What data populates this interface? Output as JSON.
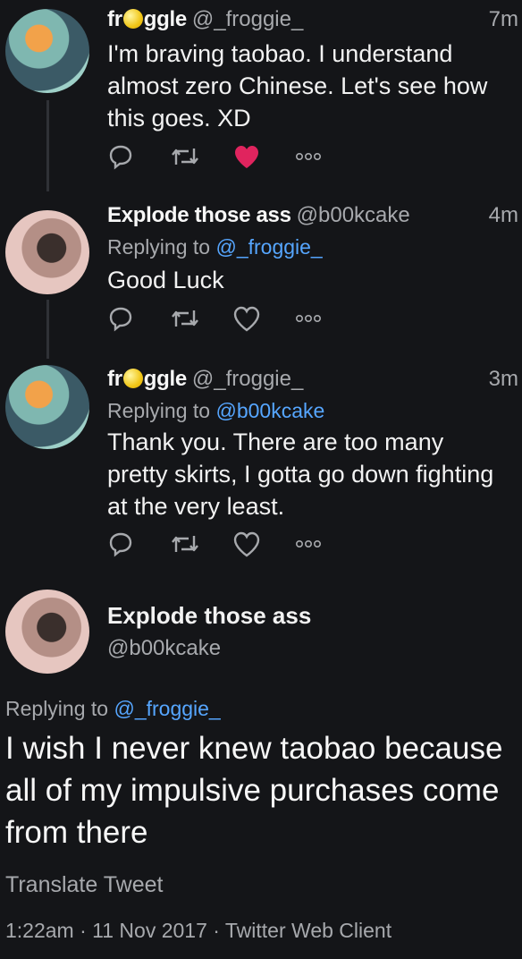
{
  "tweets": [
    {
      "name_pre": "fr",
      "name_post": "ggle",
      "handle": "@_froggie_",
      "time": "7m",
      "text_lines": [
        "I'm braving taobao. I understand",
        "almost zero Chinese. Let's see how",
        "this goes. XD"
      ],
      "liked": true
    },
    {
      "name": "Explode those ass",
      "handle": "@b00kcake",
      "time": "4m",
      "replying_prefix": "Replying to",
      "replying_to": "@_froggie_",
      "text_lines": [
        "Good Luck"
      ]
    },
    {
      "name_pre": "fr",
      "name_post": "ggle",
      "handle": "@_froggie_",
      "time": "3m",
      "replying_prefix": "Replying to",
      "replying_to": "@b00kcake",
      "text_lines": [
        "Thank you. There are too many",
        "pretty skirts, I gotta go down fighting",
        "at the very least."
      ]
    }
  ],
  "main": {
    "name": "Explode those ass",
    "handle": "@b00kcake",
    "replying_prefix": "Replying to",
    "replying_to": "@_froggie_",
    "text_lines": [
      "I wish I never knew taobao because",
      "all of my impulsive purchases come",
      "from there"
    ],
    "translate": "Translate Tweet",
    "meta": "1:22am · 11 Nov 2017 · Twitter Web Client"
  },
  "colors": {
    "background": "#141518",
    "link": "#56a6ff",
    "muted": "#a7a9ad",
    "like": "#e0245e"
  },
  "icons": [
    "reply-icon",
    "retweet-icon",
    "like-icon",
    "more-icon"
  ]
}
